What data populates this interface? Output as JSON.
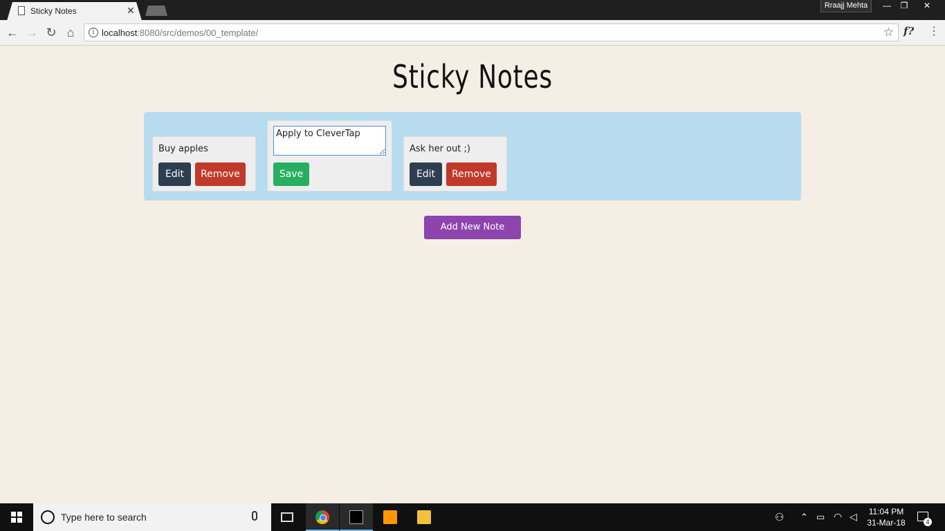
{
  "browser": {
    "tab_title": "Sticky Notes",
    "profile_name": "Rraajj Mehta",
    "url_host": "localhost",
    "url_path": ":8080/src/demos/00_template/",
    "ext_label": "f?"
  },
  "page": {
    "title": "Sticky Notes",
    "notes": [
      {
        "text": "Buy apples",
        "edit_label": "Edit",
        "remove_label": "Remove"
      },
      {
        "text": "Apply to CleverTap",
        "save_label": "Save",
        "editing": true
      },
      {
        "text": "Ask her out ;)",
        "edit_label": "Edit",
        "remove_label": "Remove"
      }
    ],
    "add_button_label": "Add New Note"
  },
  "taskbar": {
    "search_placeholder": "Type here to search",
    "time": "11:04 PM",
    "date": "31-Mar-18",
    "notification_count": "4"
  },
  "colors": {
    "page_bg": "#f5eee4",
    "board_bg": "#b8dcef",
    "edit_btn": "#2c3e50",
    "remove_btn": "#c0392b",
    "save_btn": "#27ae60",
    "add_btn": "#8e44ad"
  }
}
